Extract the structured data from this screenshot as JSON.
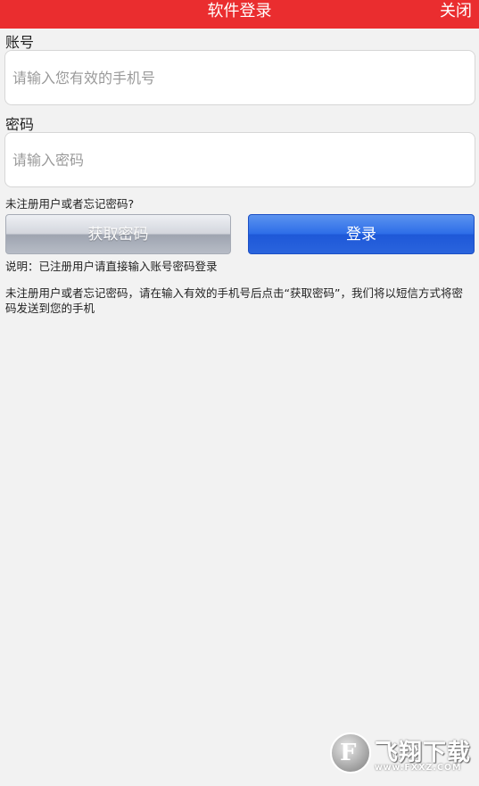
{
  "header": {
    "title": "软件登录",
    "close_label": "关闭"
  },
  "account": {
    "label": "账号",
    "placeholder": "请输入您有效的手机号",
    "value": ""
  },
  "password": {
    "label": "密码",
    "placeholder": "请输入密码",
    "value": ""
  },
  "hint": "未注册用户或者忘记密码?",
  "buttons": {
    "get_password": "获取密码",
    "login": "登录"
  },
  "notes": {
    "registered": "说明：已注册用户请直接输入账号密码登录",
    "unregistered": "未注册用户或者忘记密码，请在输入有效的手机号后点击“获取密码”，我们将以短信方式将密码发送到您的手机"
  },
  "watermark": {
    "logo_glyph": "F",
    "name": "飞翔下载",
    "url": "www.FXXZ.COM"
  },
  "colors": {
    "header": "#ea2d2f",
    "login_button": "#2e6ee8",
    "background": "#f2f2f2"
  }
}
